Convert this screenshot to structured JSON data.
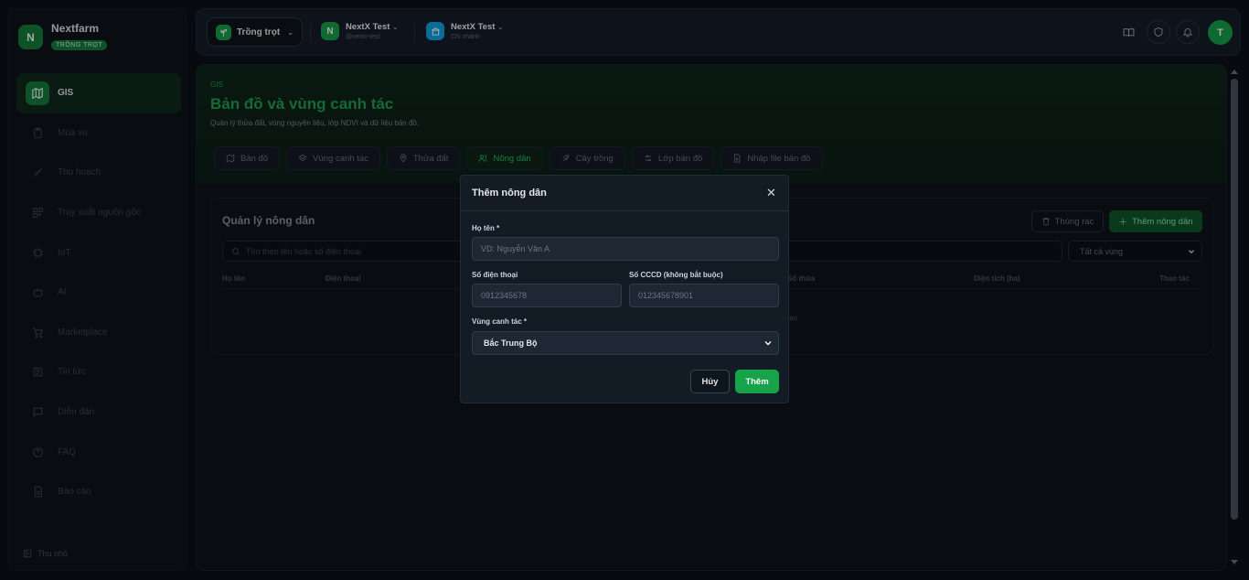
{
  "brand": {
    "name": "Nextfarm",
    "badge": "TRỒNG TRỌT",
    "logo_letter": "N"
  },
  "sidebar": {
    "items": [
      {
        "label": "GIS",
        "icon": "map-icon",
        "active": true
      },
      {
        "label": "Mùa vụ",
        "icon": "clipboard-icon"
      },
      {
        "label": "Thu hoạch",
        "icon": "harvest-icon"
      },
      {
        "label": "Truy xuất nguồn gốc",
        "icon": "qr-code-icon"
      },
      {
        "label": "IoT",
        "icon": "cpu-icon"
      },
      {
        "label": "AI",
        "icon": "bot-icon"
      },
      {
        "label": "Marketplace",
        "icon": "cart-icon"
      },
      {
        "label": "Tin tức",
        "icon": "newspaper-icon"
      },
      {
        "label": "Diễn đàn",
        "icon": "chat-icon"
      },
      {
        "label": "FAQ",
        "icon": "help-icon"
      },
      {
        "label": "Báo cáo",
        "icon": "report-icon"
      }
    ],
    "collapse_label": "Thu nhỏ"
  },
  "topbar": {
    "crop_select": "Trồng trọt",
    "org1": {
      "name": "NextX Test",
      "sub": "@nextx-test",
      "letter": "N"
    },
    "org2": {
      "name": "NextX Test",
      "sub": "Chi nhánh"
    },
    "avatar": "T"
  },
  "page": {
    "breadcrumb": "GIS",
    "title": "Bản đồ và vùng canh tác",
    "subtitle": "Quản lý thửa đất, vùng nguyên liệu, lớp NDVI và dữ liệu bản đồ.",
    "tabs": [
      {
        "label": "Bản đồ",
        "icon": "map-icon"
      },
      {
        "label": "Vùng canh tác",
        "icon": "layers-icon"
      },
      {
        "label": "Thửa đất",
        "icon": "pin-icon"
      },
      {
        "label": "Nông dân",
        "icon": "users-icon",
        "active": true
      },
      {
        "label": "Cây trồng",
        "icon": "leaf-icon"
      },
      {
        "label": "Lớp bản đồ",
        "icon": "sliders-icon"
      },
      {
        "label": "Nhập file bản đồ",
        "icon": "file-icon"
      }
    ]
  },
  "card": {
    "title": "Quản lý nông dân",
    "trash_label": "Thùng rác",
    "add_label": "Thêm nông dân",
    "search_placeholder": "Tìm theo tên hoặc số điện thoại",
    "region_filter": "Tất cả vùng",
    "columns": [
      "Họ tên",
      "Điện thoại",
      "Số thửa",
      "Diện tích (ha)",
      "Thao tác"
    ],
    "empty_tail": "tạo."
  },
  "modal": {
    "title": "Thêm nông dân",
    "name_label": "Họ tên *",
    "name_placeholder": "VD: Nguyễn Văn A",
    "phone_label": "Số điện thoại",
    "phone_placeholder": "0912345678",
    "id_label": "Số CCCD (không bắt buộc)",
    "id_placeholder": "012345678901",
    "region_label": "Vùng canh tác *",
    "region_value": "Bắc Trung Bộ",
    "cancel_label": "Hủy",
    "submit_label": "Thêm"
  },
  "colors": {
    "accent": "#16a34a",
    "background": "#0b1017",
    "panel": "#131b25"
  }
}
